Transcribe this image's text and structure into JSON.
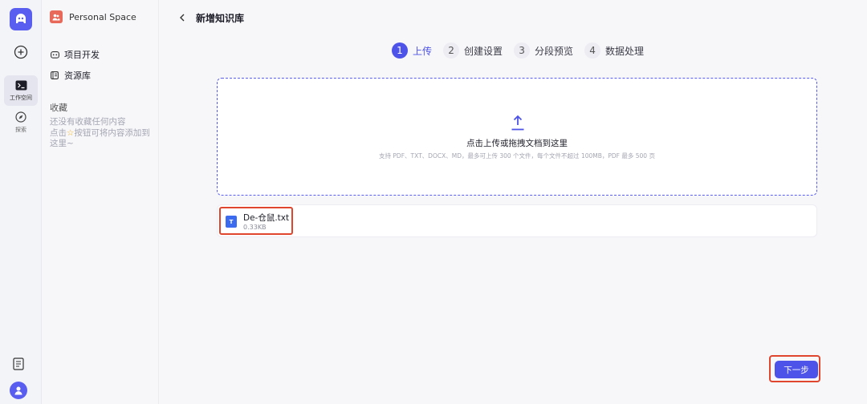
{
  "rail": {
    "workspace_label": "工作空间",
    "explore_label": "探索"
  },
  "sidebar": {
    "space_name": "Personal Space",
    "items": [
      {
        "label": "项目开发",
        "icon": "robot-icon"
      },
      {
        "label": "资源库",
        "icon": "library-icon"
      }
    ],
    "favorites_title": "收藏",
    "favorites_empty_line1": "还没有收藏任何内容",
    "favorites_empty_line2_pre": "点击",
    "favorites_empty_line2_post": "按钮可将内容添加到这里~",
    "star_color": "#f5b623"
  },
  "main": {
    "title": "新增知识库",
    "steps": [
      {
        "num": "1",
        "label": "上传",
        "active": true
      },
      {
        "num": "2",
        "label": "创建设置",
        "active": false
      },
      {
        "num": "3",
        "label": "分段预览",
        "active": false
      },
      {
        "num": "4",
        "label": "数据处理",
        "active": false
      }
    ],
    "dropzone": {
      "title": "点击上传或拖拽文档到这里",
      "hint": "支持 PDF、TXT、DOCX、MD，最多可上传 300 个文件，每个文件不超过 100MB，PDF 最多 500 页"
    },
    "file": {
      "icon_letter": "T",
      "name": "De-仓鼠.txt",
      "size": "0.33KB"
    },
    "next_label": "下一步"
  },
  "colors": {
    "accent": "#4d53e8",
    "highlight": "#e0462e",
    "space_icon": "#e8695a",
    "file_icon": "#3c6bf0"
  }
}
